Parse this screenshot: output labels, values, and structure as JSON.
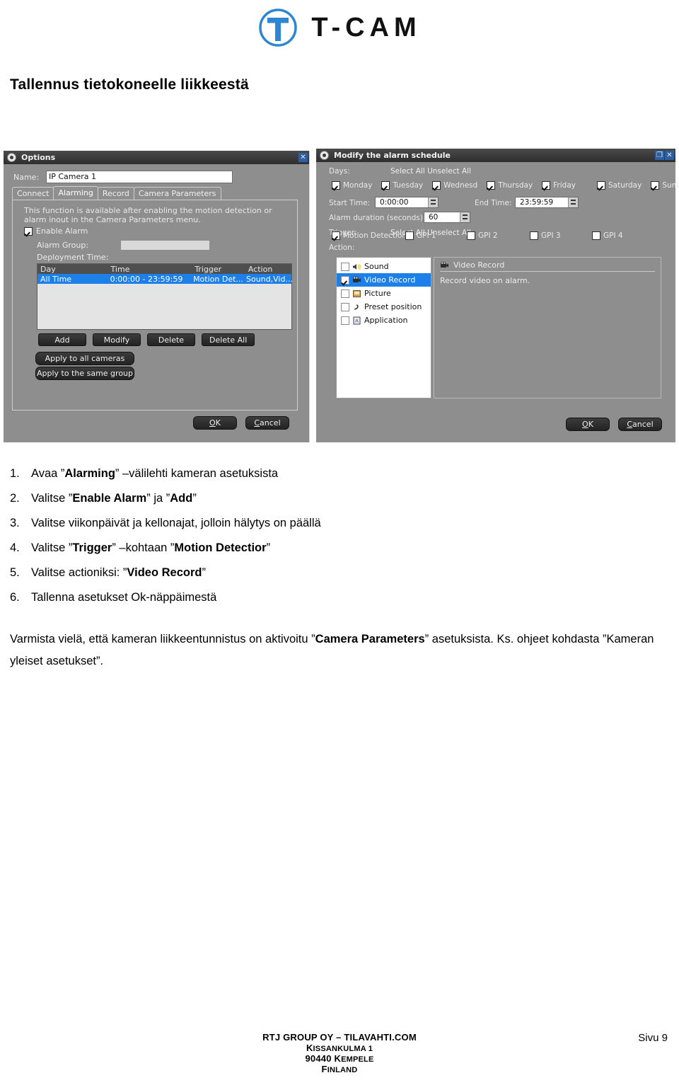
{
  "brand": {
    "logo_icon": "t-cam-circle-logo",
    "name": "T-CAM",
    "color": "#2f86d0"
  },
  "page_heading": "Tallennus tietokoneelle liikkeestä",
  "options_dialog": {
    "title": "Options",
    "title_icon": "camera-icon",
    "close_icon": "✕",
    "name_label": "Name:",
    "name_value": "IP Camera 1",
    "tabs": [
      {
        "label": "Connect",
        "active": false
      },
      {
        "label": "Alarming",
        "active": true
      },
      {
        "label": "Record",
        "active": false
      },
      {
        "label": "Camera Parameters",
        "active": false
      }
    ],
    "help_text": "This function is available after enabling the motion detection or alarm inout in the Camera Parameters menu.",
    "enable_alarm_label": "Enable Alarm",
    "enable_alarm_checked": true,
    "alarm_group_label": "Alarm Group:",
    "alarm_group_value": "",
    "deployment_time_label": "Deployment Time:",
    "table_headers": [
      "Day",
      "Time",
      "Trigger",
      "Action"
    ],
    "table_row": [
      "All Time",
      "0:00:00 - 23:59:59",
      "Motion Det...",
      "Sound,Vid..."
    ],
    "buttons": [
      "Add",
      "Modify",
      "Delete",
      "Delete All"
    ],
    "apply_all_label": "Apply to all cameras",
    "apply_group_label": "Apply to the same group",
    "ok_label": "OK",
    "cancel_label": "Cancel"
  },
  "schedule_dialog": {
    "title": "Modify the alarm schedule",
    "title_icon": "camera-icon",
    "maximize_icon": "❐",
    "close_icon": "✕",
    "days_label": "Days:",
    "days_select_all": "Select All Unselect All",
    "days": [
      {
        "label": "Monday",
        "checked": true
      },
      {
        "label": "Tuesday",
        "checked": true
      },
      {
        "label": "Wednesd",
        "checked": true
      },
      {
        "label": "Thursday",
        "checked": true
      },
      {
        "label": "Friday",
        "checked": true
      },
      {
        "label": "Saturday",
        "checked": true
      },
      {
        "label": "Sunday",
        "checked": true
      }
    ],
    "start_time_label": "Start Time:",
    "start_time_value": "0:00:00",
    "end_time_label": "End Time:",
    "end_time_value": "23:59:59",
    "alarm_duration_label": "Alarm duration (seconds):",
    "alarm_duration_value": "60",
    "trigger_label": "Trigger:",
    "trigger_select_all": "Select All Unselect All",
    "triggers": [
      {
        "label": "Motion Detectior",
        "checked": true
      },
      {
        "label": "GPI 1",
        "checked": false
      },
      {
        "label": "GPI 2",
        "checked": false
      },
      {
        "label": "GPI 3",
        "checked": false
      },
      {
        "label": "GPI 4",
        "checked": false
      }
    ],
    "action_label": "Action:",
    "actions": [
      {
        "label": "Sound",
        "icon": "speaker-icon",
        "checked": false,
        "selected": false
      },
      {
        "label": "Video Record",
        "icon": "camcorder-icon",
        "checked": true,
        "selected": true
      },
      {
        "label": "Picture",
        "icon": "picture-icon",
        "checked": false,
        "selected": false
      },
      {
        "label": "Preset position",
        "icon": "preset-arrow-icon",
        "checked": false,
        "selected": false
      },
      {
        "label": "Application",
        "icon": "application-icon",
        "checked": false,
        "selected": false
      }
    ],
    "detail_title": "Video Record",
    "detail_icon": "camcorder-icon",
    "detail_text": "Record video on alarm.",
    "ok_label": "OK",
    "cancel_label": "Cancel"
  },
  "steps": [
    {
      "num": "1.",
      "html": "Avaa ”<b>Alarming</b>” –välilehti kameran asetuksista"
    },
    {
      "num": "2.",
      "html": "Valitse ”<b>Enable Alarm</b>” ja ”<b>Add</b>”"
    },
    {
      "num": "3.",
      "html": "Valitse viikonpäivät ja kellonajat, jolloin hälytys on päällä"
    },
    {
      "num": "4.",
      "html": "Valitse ”<b>Trigger</b>” –kohtaan ”<b>Motion Detectior</b>”"
    },
    {
      "num": "5.",
      "html": "Valitse actioniksi: ”<b>Video Record</b>”"
    },
    {
      "num": "6.",
      "html": "Tallenna asetukset Ok-näppäimestä"
    }
  ],
  "paragraph_html": "Varmista vielä, että kameran liikkeentunnistus on aktivoitu ”<b>Camera Parameters</b>” asetuksista. Ks. ohjeet kohdasta ”Kameran yleiset asetukset”.",
  "footer": {
    "company": "RTJ GROUP OY – TILAVAHTI.COM",
    "address_line1_cap": "K",
    "address_line1_rest": "ISSANKULMA 1",
    "address_line2_pre": "90440 ",
    "address_line2_cap": "K",
    "address_line2_rest": "EMPELE",
    "address_line3_cap": "F",
    "address_line3_rest": "INLAND",
    "page": "Sivu 9"
  }
}
